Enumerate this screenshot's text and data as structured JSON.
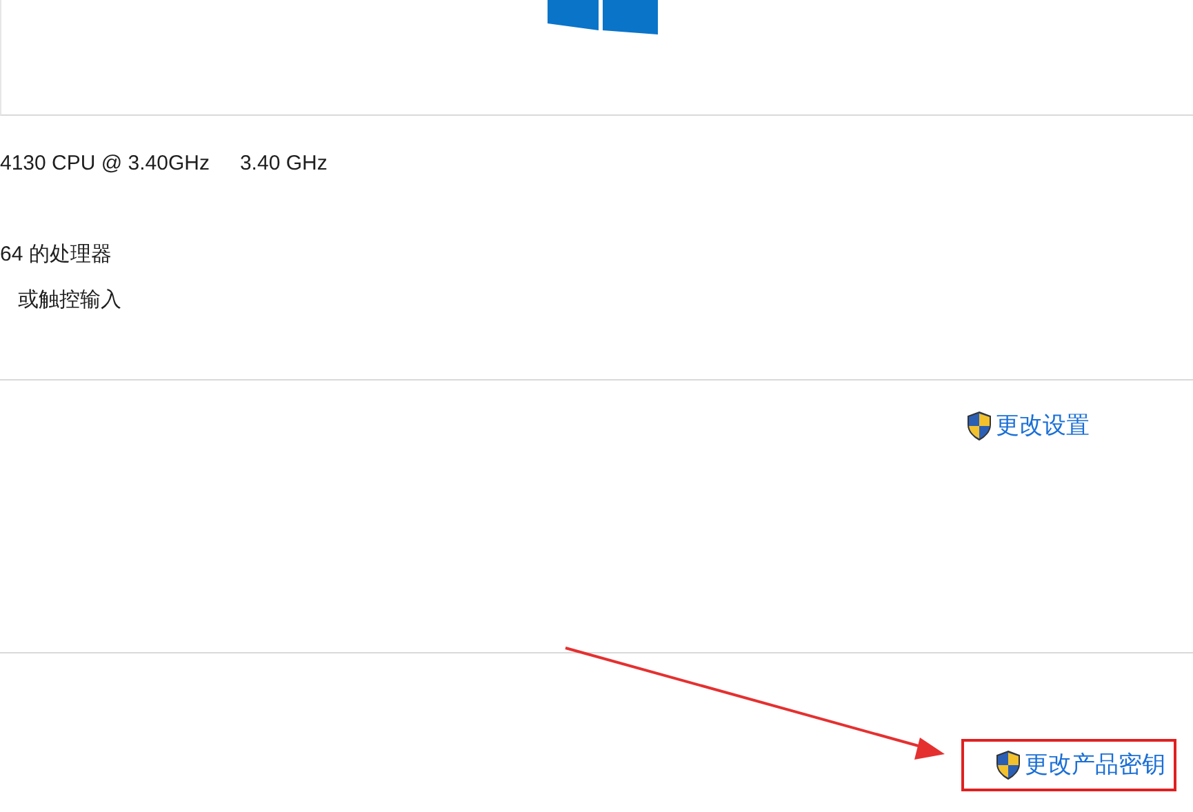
{
  "processor": {
    "name": "4130 CPU @ 3.40GHz",
    "speed": "3.40 GHz"
  },
  "system_type": "64 的处理器",
  "pen_touch": "或触控输入",
  "computer_name_section": {
    "link": "更改设置"
  },
  "activation_section": {
    "link": "更改产品密钥"
  }
}
